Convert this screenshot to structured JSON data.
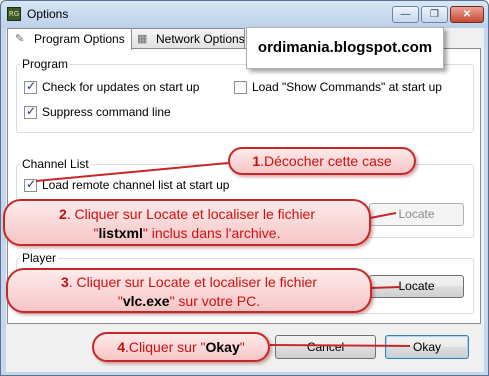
{
  "window": {
    "title": "Options",
    "app_icon_text": "RG",
    "buttons": {
      "minimize": "—",
      "maximize": "❐",
      "close": "✕"
    }
  },
  "tabs": [
    {
      "label": "Program Options",
      "icon": "pencil-icon",
      "active": true
    },
    {
      "label": "Network Options",
      "icon": "network-icon",
      "active": false
    }
  ],
  "program_group": {
    "label": "Program",
    "check_updates": {
      "label": "Check for updates on start up",
      "checked": true
    },
    "load_show_commands": {
      "label": "Load \"Show Commands\" at start up",
      "checked": false
    },
    "suppress_cmdline": {
      "label": "Suppress command line",
      "checked": true
    }
  },
  "channel_group": {
    "label": "Channel List",
    "load_remote": {
      "label": "Load remote channel list at start up",
      "checked": true
    },
    "locate_label": "Locate"
  },
  "player_group": {
    "label": "Player",
    "locate_label": "Locate"
  },
  "dialog_buttons": {
    "cancel": "Cancel",
    "okay": "Okay"
  },
  "overlay": {
    "blog": "ordimania.blogspot.com",
    "callouts": [
      {
        "num": "1",
        "text": ".Décocher cette case"
      },
      {
        "num": "2",
        "text_a": ". Cliquer sur Locate et localiser le fichier",
        "q1": "\"",
        "bold": "listxml",
        "q2": "\"",
        "text_b": " inclus dans l'archive."
      },
      {
        "num": "3",
        "text_a": ". Cliquer sur Locate et localiser le fichier",
        "q1": "\"",
        "bold": "vlc.exe",
        "q2": "\"",
        "text_b": " sur votre PC."
      },
      {
        "num": "4",
        "text_a": ".Cliquer sur \"",
        "bold": "Okay",
        "text_b": "\""
      }
    ]
  },
  "colors": {
    "callout_border": "#c62828",
    "callout_text": "#d01010",
    "accent": "#3c7fb1"
  }
}
